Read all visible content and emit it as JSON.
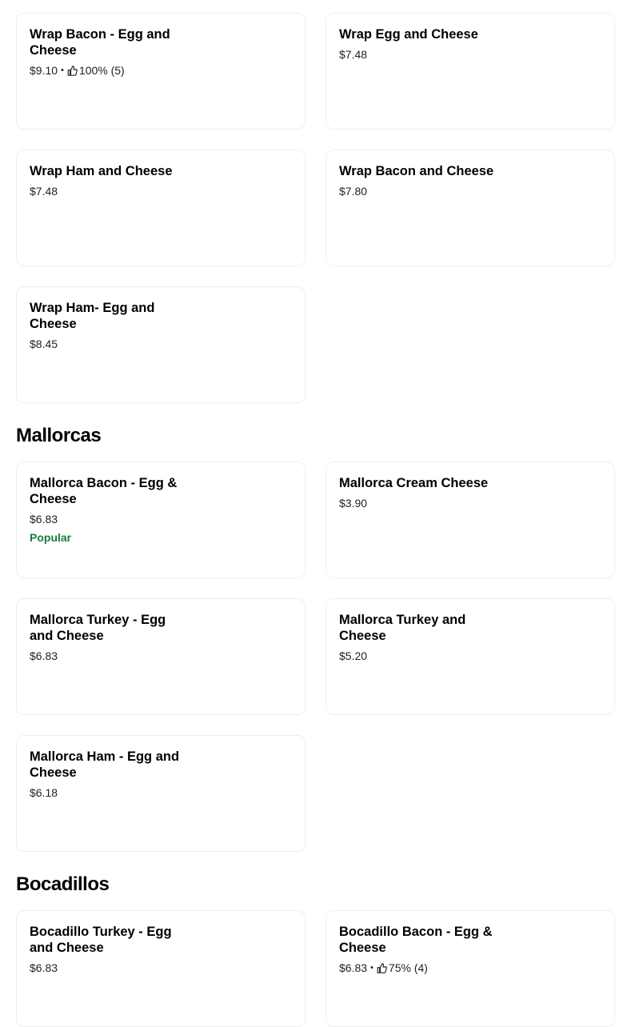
{
  "sections": {
    "wraps": {
      "items": [
        {
          "name": "Wrap Bacon - Egg and Cheese",
          "price": "$9.10",
          "rating": "100% (5)"
        },
        {
          "name": "Wrap Egg and Cheese",
          "price": "$7.48"
        },
        {
          "name": "Wrap Ham and Cheese",
          "price": "$7.48"
        },
        {
          "name": "Wrap Bacon and Cheese",
          "price": "$7.80"
        },
        {
          "name": "Wrap Ham- Egg and Cheese",
          "price": "$8.45"
        }
      ]
    },
    "mallorcas": {
      "title": "Mallorcas",
      "items": [
        {
          "name": "Mallorca Bacon - Egg & Cheese",
          "price": "$6.83",
          "badge": "Popular"
        },
        {
          "name": "Mallorca Cream Cheese",
          "price": "$3.90"
        },
        {
          "name": "Mallorca Turkey - Egg and Cheese",
          "price": "$6.83"
        },
        {
          "name": "Mallorca Turkey and Cheese",
          "price": "$5.20"
        },
        {
          "name": "Mallorca Ham - Egg and Cheese",
          "price": "$6.18"
        }
      ]
    },
    "bocadillos": {
      "title": "Bocadillos",
      "items": [
        {
          "name": "Bocadillo Turkey - Egg and Cheese",
          "price": "$6.83"
        },
        {
          "name": "Bocadillo Bacon - Egg & Cheese",
          "price": "$6.83",
          "rating": "75% (4)"
        }
      ]
    }
  },
  "separator": "•",
  "icons": {
    "rating": "thumbs-up-icon"
  },
  "colors": {
    "popular": "#1d7a3a",
    "border": "#eeeeee"
  }
}
